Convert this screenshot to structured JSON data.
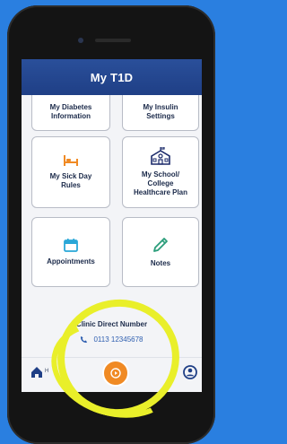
{
  "app": {
    "title": "My T1D"
  },
  "tiles": {
    "diabetes_info": "My Diabetes\nInformation",
    "insulin_settings": "My Insulin\nSettings",
    "sick_day_rules": "My Sick Day\nRules",
    "school_plan": "My School/\nCollege\nHealthcare Plan",
    "appointments": "Appointments",
    "notes": "Notes"
  },
  "clinic": {
    "title": "Clinic Direct Number",
    "phone": "0113 12345678"
  },
  "bottom_nav": {
    "home_label": "H"
  },
  "colors": {
    "header": "#1f3f86",
    "accent_orange": "#f08a24",
    "highlight_yellow": "#e9ef2a",
    "background_blue": "#2a7fe0"
  },
  "icons": [
    "bed-icon",
    "school-icon",
    "calendar-icon",
    "pencil-icon",
    "phone-icon",
    "home-icon",
    "play-icon",
    "profile-icon"
  ]
}
